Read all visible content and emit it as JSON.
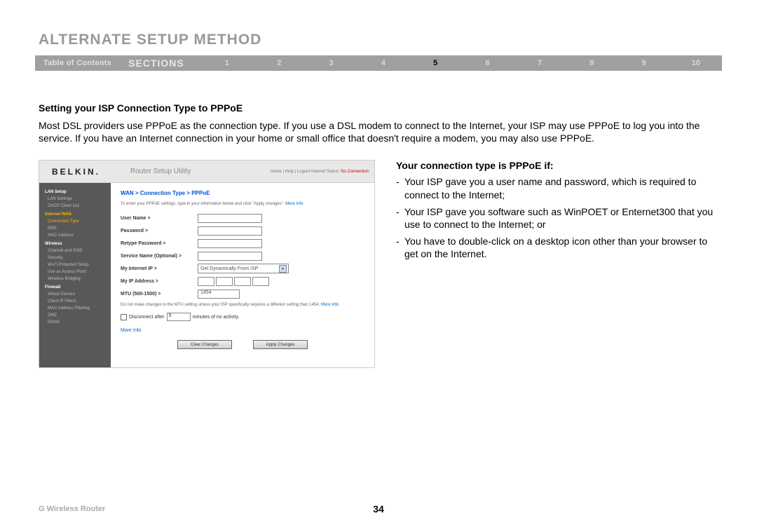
{
  "page_title": "ALTERNATE SETUP METHOD",
  "nav": {
    "toc": "Table of Contents",
    "sections_label": "SECTIONS",
    "items": [
      "1",
      "2",
      "3",
      "4",
      "5",
      "6",
      "7",
      "8",
      "9",
      "10"
    ],
    "active": "5"
  },
  "section_heading": "Setting your ISP Connection Type to PPPoE",
  "body_text": "Most DSL providers use PPPoE as the connection type. If you use a DSL modem to connect to the Internet, your ISP may use PPPoE to log you into the service. If you have an Internet connection in your home or small office that doesn't require a modem, you may also use PPPoE.",
  "right_col": {
    "heading": "Your connection type is PPPoE if:",
    "bullets": [
      "Your ISP gave you a user name and password, which is required to connect to the Internet;",
      "Your ISP gave you software such as WinPOET or Enternet300 that you use to connect to the Internet; or",
      "You have to double-click on a desktop icon other than your browser to get on the Internet."
    ]
  },
  "router": {
    "logo": "BELKIN.",
    "header_title": "Router Setup Utility",
    "header_links": "Home | Help | Logout   Internet Status: ",
    "header_status": "No Connection",
    "breadcrumb": "WAN > Connection Type > PPPoE",
    "instr_prefix": "To enter your PPPoE settings, type in your information below and click \"Apply changes\". ",
    "more_info": "More Info",
    "sidebar": {
      "groups": [
        {
          "title": "LAN Setup",
          "items": [
            "LAN Settings",
            "DHCP Client List"
          ]
        },
        {
          "title": "Internet WAN",
          "items": [
            "Connection Type",
            "DNS",
            "MAC Address"
          ],
          "active": "Connection Type",
          "title_color": "#ffb000"
        },
        {
          "title": "Wireless",
          "items": [
            "Channel and SSID",
            "Security",
            "Wi-Fi Protected Setup",
            "Use as Access Point",
            "Wireless Bridging"
          ]
        },
        {
          "title": "Firewall",
          "items": [
            "Virtual Servers",
            "Client IP Filters",
            "MAC Address Filtering",
            "DMZ",
            "DDNS"
          ]
        }
      ]
    },
    "form": {
      "user_name": "User Name >",
      "password": "Password >",
      "retype_password": "Retype Password >",
      "service_name": "Service Name (Optional) >",
      "my_internet_ip": "My Internet IP >",
      "ip_select_value": "Get Dynamically From ISP",
      "my_ip_address": "My IP Address >",
      "mtu": "MTU (500-1500) >",
      "mtu_value": "1454",
      "mtu_note": "Do not make changes to the MTU setting unless your ISP specifically requires a different setting than 1454. ",
      "disconnect_label_pre": "Disconnect after",
      "disconnect_value": "5",
      "disconnect_label_post": "minutes of no activity.",
      "clear": "Clear Changes",
      "apply": "Apply Changes"
    }
  },
  "footer": {
    "left": "G Wireless Router",
    "page": "34"
  }
}
